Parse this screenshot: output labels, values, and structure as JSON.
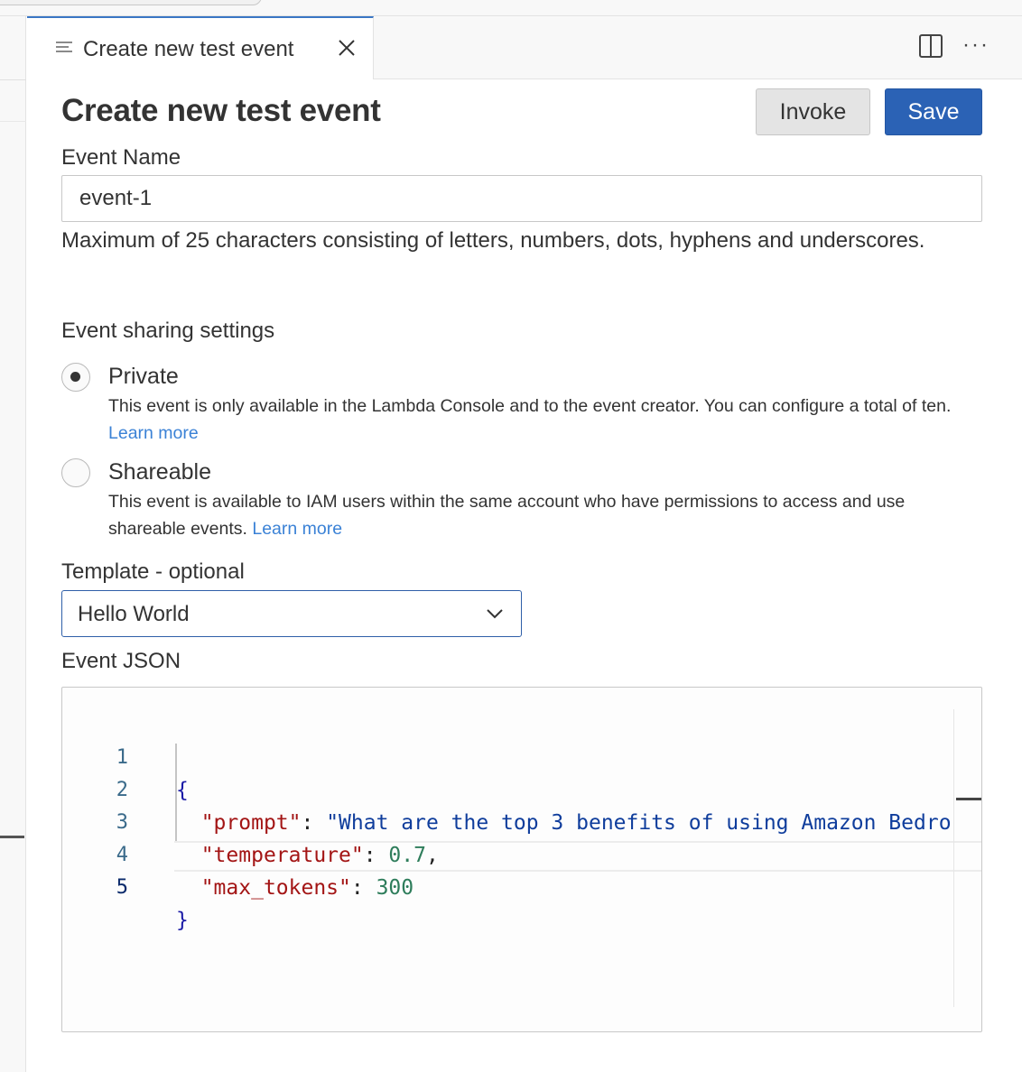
{
  "tab": {
    "label": "Create new test event",
    "icon": "file-lines-icon",
    "close_icon": "close-icon"
  },
  "tab_actions": {
    "split_icon": "split-editor-icon",
    "more_label": "···"
  },
  "header": {
    "title": "Create new test event",
    "invoke_label": "Invoke",
    "save_label": "Save"
  },
  "event_name": {
    "label": "Event Name",
    "value": "event-1",
    "help": "Maximum of 25 characters consisting of letters, numbers, dots, hyphens and underscores."
  },
  "sharing": {
    "label": "Event sharing settings",
    "options": [
      {
        "title": "Private",
        "checked": true,
        "description": "This event is only available in the Lambda Console and to the event creator. You can configure a total of ten.",
        "link": "Learn more"
      },
      {
        "title": "Shareable",
        "checked": false,
        "description": "This event is available to IAM users within the same account who have permissions to access and use shareable events.",
        "link": "Learn more"
      }
    ]
  },
  "template": {
    "label": "Template - optional",
    "value": "Hello World"
  },
  "event_json": {
    "label": "Event JSON",
    "line_numbers": [
      "1",
      "2",
      "3",
      "4",
      "5"
    ],
    "lines": {
      "l1_brace": "{",
      "l2_key": "\"prompt\"",
      "l2_colon": ": ",
      "l2_value": "\"What are the top 3 benefits of using Amazon Bedro",
      "l3_key": "\"temperature\"",
      "l3_colon": ": ",
      "l3_value": "0.7",
      "l3_comma": ",",
      "l4_key": "\"max_tokens\"",
      "l4_colon": ": ",
      "l4_value": "300",
      "l5_brace": "}"
    }
  },
  "colors": {
    "accent": "#2b62b5",
    "link": "#3b82d6",
    "json_key": "#a31515",
    "json_string": "#0f3d9c",
    "json_number": "#2e7d5b"
  }
}
